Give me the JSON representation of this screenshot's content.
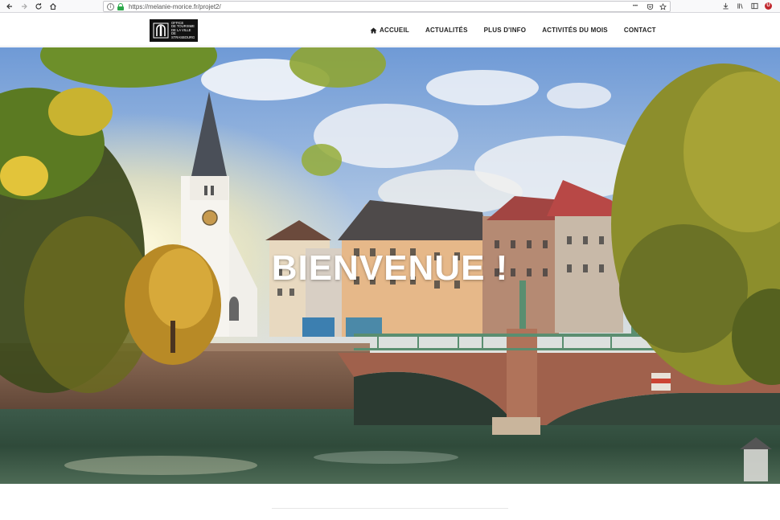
{
  "browser": {
    "url": "https://melanie-morice.fr/projet2/",
    "icons": {
      "back": "back-arrow-icon",
      "forward": "forward-arrow-icon",
      "reload": "reload-icon",
      "home": "home-icon",
      "info": "info-icon",
      "lock": "lock-icon",
      "more": "more-icon",
      "pocket": "pocket-icon",
      "bookmark": "bookmark-star-icon",
      "download": "download-icon",
      "library": "library-icon",
      "sidebar": "sidebar-icon",
      "extension": "extension-icon"
    },
    "info_glyph": "i",
    "more_glyph": "•••",
    "extension_glyph": "U"
  },
  "logo": {
    "lines": [
      "Office",
      "de tourisme",
      "de la ville",
      "de",
      "Strasbourg"
    ]
  },
  "nav": {
    "items": [
      {
        "label": "ACCUEIL",
        "icon": "home-icon"
      },
      {
        "label": "ACTUALITÉS"
      },
      {
        "label": "PLUS D'INFO"
      },
      {
        "label": "ACTIVITÉS DU MOIS"
      },
      {
        "label": "CONTACT"
      }
    ]
  },
  "hero": {
    "title": "BIENVENUE !"
  },
  "colors": {
    "accent_green": "#2ba84a",
    "nav_text": "#222222",
    "logo_bg": "#111111",
    "hero_title": "#ffffff"
  }
}
